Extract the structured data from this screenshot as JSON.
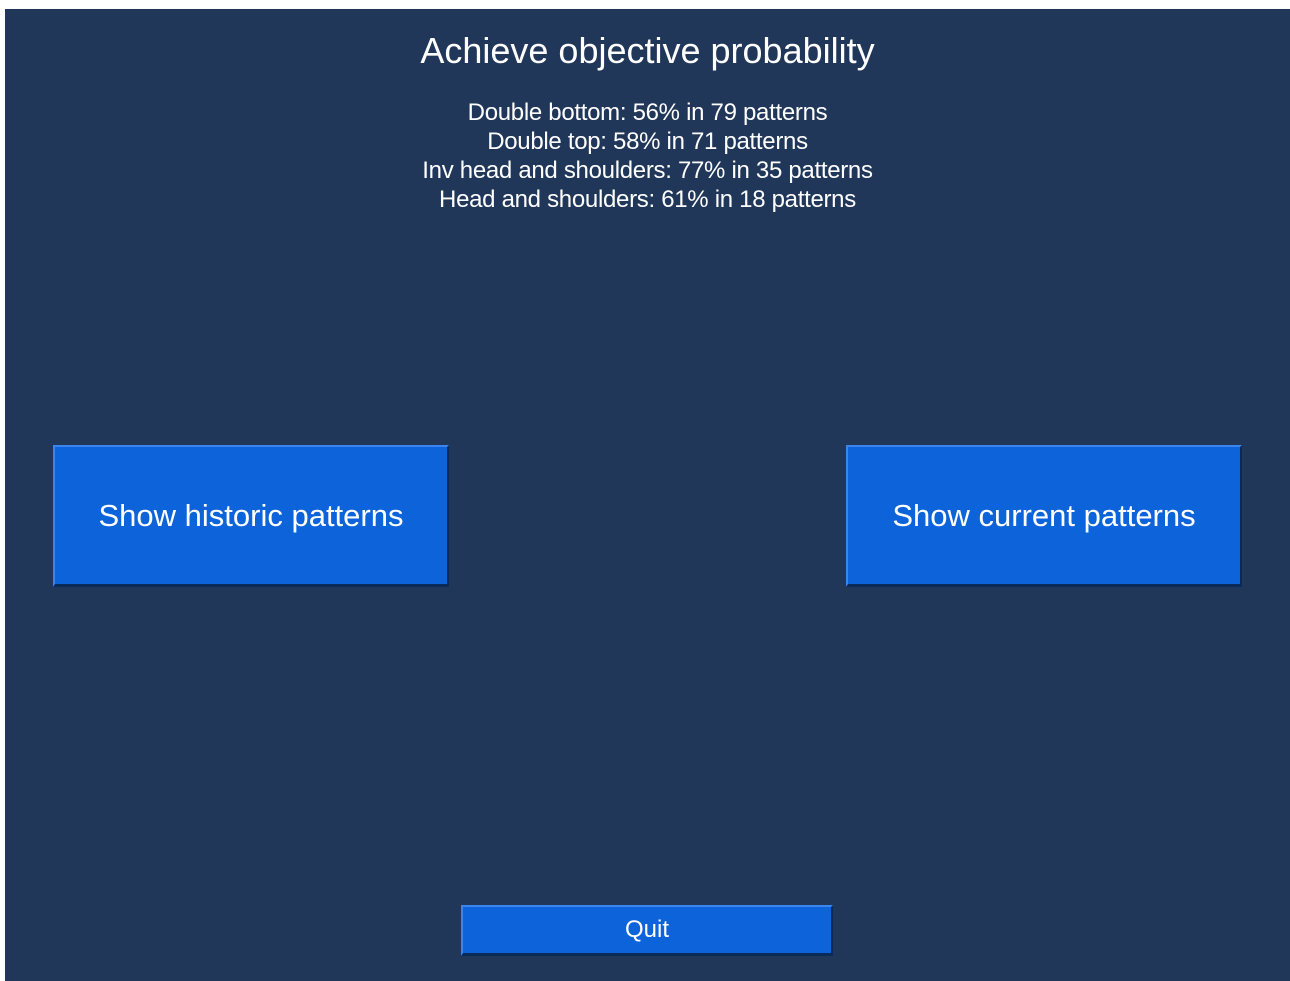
{
  "title": "Achieve objective probability",
  "stats": [
    "Double bottom: 56% in 79 patterns",
    "Double top: 58% in 71 patterns",
    "Inv head and shoulders: 77% in 35 patterns",
    "Head and shoulders: 61% in 18 patterns"
  ],
  "buttons": {
    "historic": "Show historic patterns",
    "current": "Show current patterns",
    "quit": "Quit"
  },
  "colors": {
    "background": "#21375a",
    "button": "#0d63da",
    "text": "#ffffff"
  }
}
